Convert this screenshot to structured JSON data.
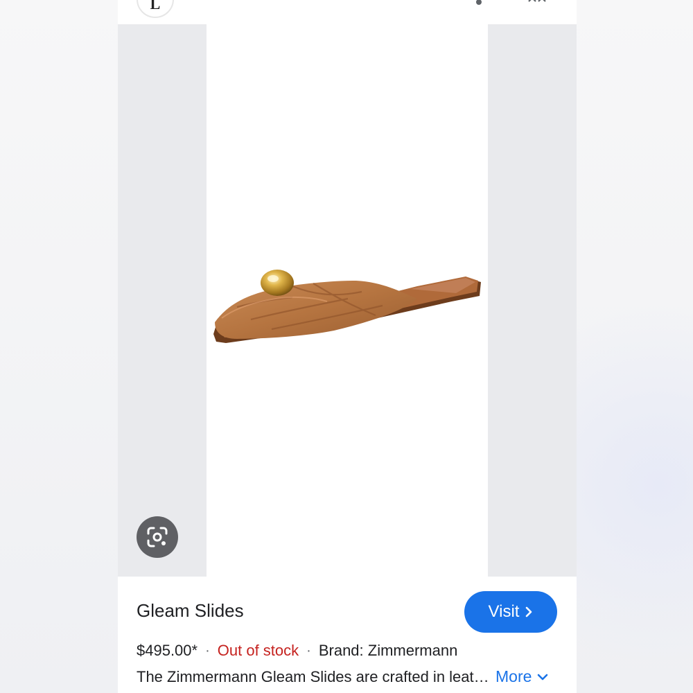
{
  "header": {
    "logo_letter": "L",
    "more_icon": "more-vert-icon",
    "close_icon": "close-icon"
  },
  "image": {
    "product_image": "brown-leather-slide-sandal",
    "lens_icon": "image-search-icon"
  },
  "product": {
    "title": "Gleam Slides",
    "visit_label": "Visit",
    "price": "$495.00*",
    "stock": "Out of stock",
    "brand": "Brand: Zimmermann",
    "description": "The Zimmermann Gleam Slides are crafted in leather with a gold-tone hardware accent.",
    "more_label": "More"
  },
  "colors": {
    "accent": "#1a73e8",
    "stock": "#c5221f",
    "panel_bg": "#ffffff",
    "image_bg": "#e9eaed"
  }
}
